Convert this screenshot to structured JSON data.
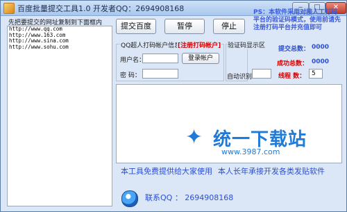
{
  "window": {
    "title": "百度批量提交工具1.0  开发者QQ：2694908168",
    "minimize": "‒",
    "maximize": "□",
    "close": "✕"
  },
  "url_panel": {
    "label": "先把要提交的网址复制到下面框内",
    "urls": [
      "http://www.qq.com",
      "http://www.163.com",
      "http://www.sina.com",
      "http://www.sohu.com"
    ]
  },
  "toolbar": {
    "submit_label": "提交百度",
    "pause_label": "暂停",
    "stop_label": "停止"
  },
  "notice": "PS：本软件采用对接人工打码平台的验证码模式，使用前请先注册打码平台并充值即可",
  "account": {
    "group_title": "QQ超人打码帐户信息",
    "register_link": "[注册打码帐户]",
    "username_label": "用户名：",
    "password_label": "密  码：",
    "login_button": "登录帐户"
  },
  "captcha": {
    "group_title": "验证码显示区",
    "auto_label": "自动识别："
  },
  "stats": {
    "submitted_label": "提交总数：",
    "submitted_value": "0000",
    "success_label": "成功总数：",
    "success_value": "0000",
    "threads_label": "线程  数：",
    "threads_value": "5"
  },
  "watermark": {
    "text": "统一下载站",
    "url": "www.3987.com"
  },
  "footer": {
    "line1": "本工具免费提供给大家使用",
    "line2": "本人长年承接开发各类发贴软件",
    "qq_line": "联系QQ ： 2694908168"
  },
  "colors": {
    "window_bg": "#dbe7f6",
    "accent_blue": "#2d4fd0",
    "accent_red": "#d40000"
  }
}
